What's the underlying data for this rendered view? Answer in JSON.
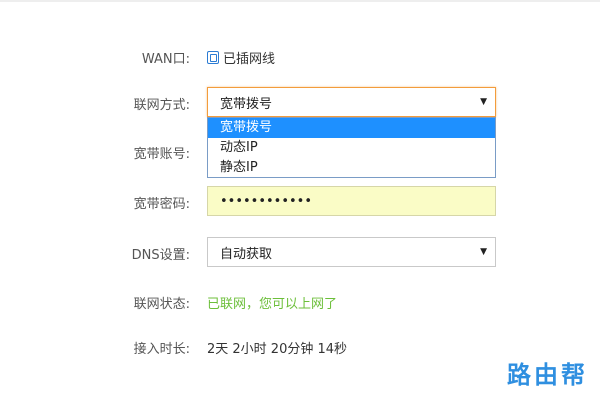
{
  "form": {
    "wan": {
      "label": "WAN口:",
      "status_text": "已插网线"
    },
    "connection_type": {
      "label": "联网方式:",
      "selected": "宽带拨号",
      "options": [
        "宽带拨号",
        "动态IP",
        "静态IP"
      ]
    },
    "account": {
      "label": "宽带账号:"
    },
    "password": {
      "label": "宽带密码:",
      "value": "••••••••••••"
    },
    "dns": {
      "label": "DNS设置:",
      "selected": "自动获取"
    },
    "status": {
      "label": "联网状态:",
      "value": "已联网，您可以上网了"
    },
    "uptime": {
      "label": "接入时长:",
      "value": "2天 2小时 20分钟 14秒"
    }
  },
  "watermark": "路由帮",
  "colors": {
    "status_ok": "#6cbf3a",
    "dropdown_highlight": "#1e90ff",
    "focus_border": "#f39c3c",
    "password_bg": "#fafcc6",
    "watermark": "#2f8fe0"
  },
  "icons": {
    "wan_status": "ethernet-plug-icon",
    "select_caret": "caret-down-icon"
  }
}
